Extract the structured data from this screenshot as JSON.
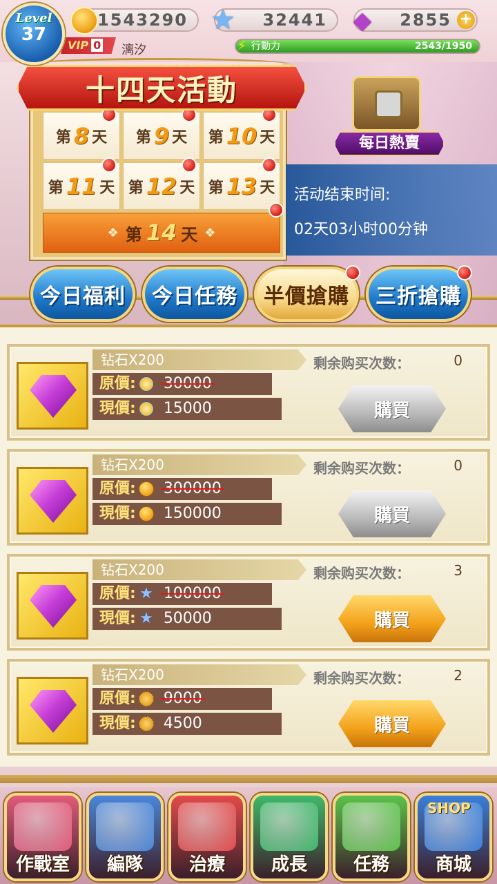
{
  "player": {
    "level_label": "Level",
    "level": "37",
    "vip_label": "VIP",
    "vip_level": "0",
    "name": "漓汐"
  },
  "resources": {
    "gold": "1543290",
    "stars": "32441",
    "gems": "2855",
    "plus": "+",
    "stamina_label": "行動力",
    "stamina_value": "2543/1950",
    "stamina_fill_fraction": 1.0
  },
  "event": {
    "title": "十四天活動",
    "days": [
      {
        "prefix": "第",
        "num": "8",
        "suffix": "天"
      },
      {
        "prefix": "第",
        "num": "9",
        "suffix": "天"
      },
      {
        "prefix": "第",
        "num": "10",
        "suffix": "天"
      },
      {
        "prefix": "第",
        "num": "11",
        "suffix": "天"
      },
      {
        "prefix": "第",
        "num": "12",
        "suffix": "天"
      },
      {
        "prefix": "第",
        "num": "13",
        "suffix": "天"
      }
    ],
    "final_day": {
      "prefix": "第",
      "num": "14",
      "suffix": "天"
    },
    "daily_sale_label": "每日熱賣",
    "countdown_title": "活动结束时间:",
    "countdown_value": "02天03小时00分钟"
  },
  "tabs": [
    {
      "label": "今日福利",
      "active": false
    },
    {
      "label": "今日任務",
      "active": false
    },
    {
      "label": "半價搶購",
      "active": true
    },
    {
      "label": "三折搶購",
      "active": false
    }
  ],
  "items": [
    {
      "name": "钻石X200",
      "orig_label": "原價:",
      "orig_price": "30000",
      "now_label": "現價:",
      "now_price": "15000",
      "currency": "trophy",
      "remain_label": "剩余购买次数：",
      "remain": "0",
      "buy_label": "購買",
      "buy_enabled": false
    },
    {
      "name": "钻石X200",
      "orig_label": "原價:",
      "orig_price": "300000",
      "now_label": "現價:",
      "now_price": "150000",
      "currency": "gold",
      "remain_label": "剩余购买次数：",
      "remain": "0",
      "buy_label": "購買",
      "buy_enabled": false
    },
    {
      "name": "钻石X200",
      "orig_label": "原價:",
      "orig_price": "100000",
      "now_label": "現價:",
      "now_price": "50000",
      "currency": "star",
      "remain_label": "剩余购买次数：",
      "remain": "3",
      "buy_label": "購買",
      "buy_enabled": true
    },
    {
      "name": "钻石X200",
      "orig_label": "原價:",
      "orig_price": "9000",
      "now_label": "現價:",
      "now_price": "4500",
      "currency": "cookie",
      "remain_label": "剩余购买次数：",
      "remain": "2",
      "buy_label": "購買",
      "buy_enabled": true
    }
  ],
  "nav": [
    {
      "label": "作戰室",
      "icon": "house-icon",
      "color": "#e25b7a"
    },
    {
      "label": "編隊",
      "icon": "banner-icon",
      "color": "#4a86d8"
    },
    {
      "label": "治療",
      "icon": "medkit-icon",
      "color": "#e24a4a"
    },
    {
      "label": "成長",
      "icon": "crown-icon",
      "color": "#3fb86a"
    },
    {
      "label": "任務",
      "icon": "clipboard-icon",
      "color": "#5cc24a"
    },
    {
      "label": "商城",
      "icon": "shop-icon",
      "color": "#3a7fd8",
      "badge": "SHOP"
    }
  ],
  "colors": {
    "accent_gold": "#f4d682",
    "tab_blue": "#1f78c8",
    "buy_orange": "#f3a21a",
    "buy_grey": "#b9b9b9"
  }
}
